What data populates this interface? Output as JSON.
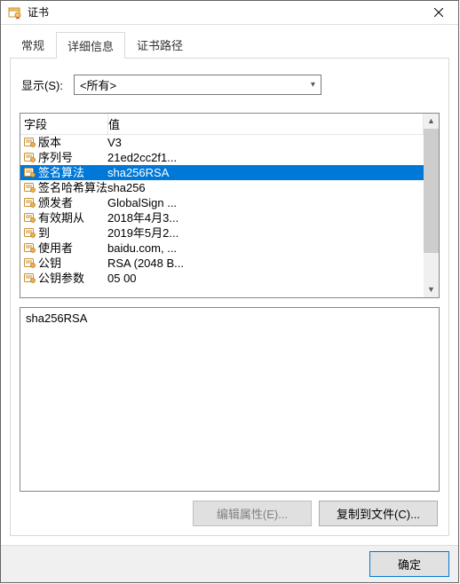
{
  "window": {
    "title": "证书"
  },
  "tabs": {
    "general": "常规",
    "details": "详细信息",
    "path": "证书路径",
    "active_index": 1
  },
  "show": {
    "label": "显示(S):",
    "value": "<所有>"
  },
  "columns": {
    "field": "字段",
    "value": "值"
  },
  "rows": [
    {
      "field": "版本",
      "value": "V3"
    },
    {
      "field": "序列号",
      "value": "21ed2cc2f1..."
    },
    {
      "field": "签名算法",
      "value": "sha256RSA",
      "selected": true
    },
    {
      "field": "签名哈希算法",
      "value": "sha256"
    },
    {
      "field": "颁发者",
      "value": "GlobalSign ..."
    },
    {
      "field": "有效期从",
      "value": "2018年4月3..."
    },
    {
      "field": "到",
      "value": "2019年5月2..."
    },
    {
      "field": "使用者",
      "value": "baidu.com, ..."
    },
    {
      "field": "公钥",
      "value": "RSA (2048 B..."
    },
    {
      "field": "公钥参数",
      "value": "05 00"
    }
  ],
  "detail_text": "sha256RSA",
  "buttons": {
    "edit": "编辑属性(E)...",
    "export": "复制到文件(C)...",
    "ok": "确定"
  }
}
